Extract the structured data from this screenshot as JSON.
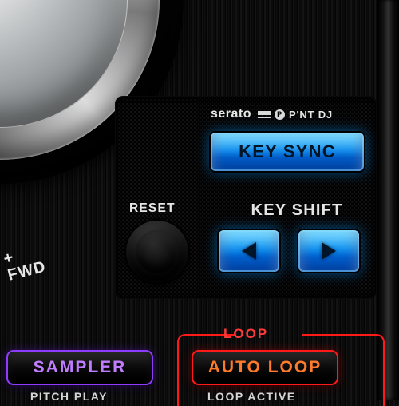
{
  "jog": {
    "direction_label": "FWD",
    "direction_symbol": "+"
  },
  "brand": {
    "primary": "serato",
    "secondary": "P'NT DJ"
  },
  "key_panel": {
    "key_sync_label": "KEY SYNC",
    "reset_label": "RESET",
    "key_shift_label": "KEY SHIFT"
  },
  "bottom": {
    "loop_group_label": "LOOP",
    "sampler_label": "SAMPLER",
    "auto_loop_label": "AUTO LOOP",
    "pitch_play_sublabel": "PITCH PLAY",
    "loop_active_sublabel": "LOOP ACTIVE"
  },
  "colors": {
    "blue_button": "#0a8df0",
    "purple_accent": "#8c3bff",
    "red_accent": "#ff1a1a",
    "orange_text": "#ff7a2a"
  }
}
